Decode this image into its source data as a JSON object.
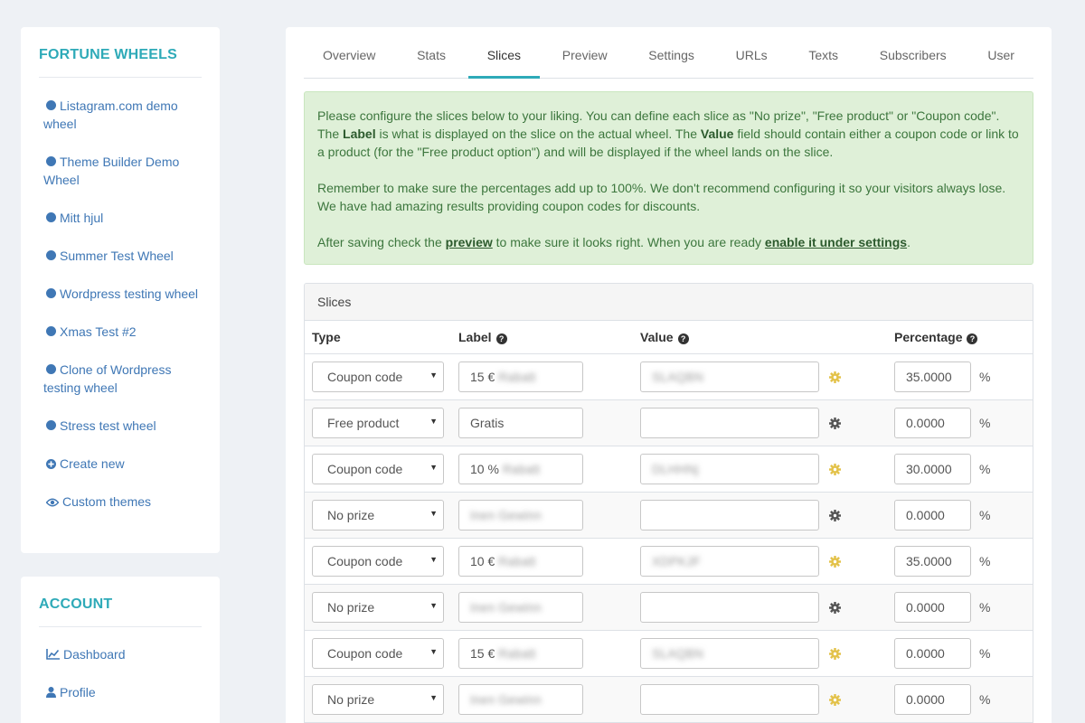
{
  "sidebar": {
    "title": "FORTUNE WHEELS",
    "wheels": [
      {
        "label": "Listagram.com demo wheel"
      },
      {
        "label": "Theme Builder Demo Wheel"
      },
      {
        "label": "Mitt hjul"
      },
      {
        "label": "Summer Test Wheel"
      },
      {
        "label": "Wordpress testing wheel"
      },
      {
        "label": "Xmas Test #2"
      },
      {
        "label": "Clone of Wordpress testing wheel"
      },
      {
        "label": "Stress test wheel"
      }
    ],
    "create_new": "Create new",
    "custom_themes": "Custom themes",
    "account_title": "ACCOUNT",
    "dashboard": "Dashboard",
    "profile": "Profile"
  },
  "tabs": [
    "Overview",
    "Stats",
    "Slices",
    "Preview",
    "Settings",
    "URLs",
    "Texts",
    "Subscribers",
    "User"
  ],
  "active_tab": "Slices",
  "info": {
    "p1_a": "Please configure the slices below to your liking. You can define each slice as \"No prize\", \"Free product\" or \"Coupon code\". The ",
    "p1_b": "Label",
    "p1_c": " is what is displayed on the slice on the actual wheel. The ",
    "p1_d": "Value",
    "p1_e": " field should contain either a coupon code or link to a product (for the \"Free product option\") and will be displayed if the wheel lands on the slice.",
    "p2": "Remember to make sure the percentages add up to 100%. We don't recommend configuring it so your visitors always lose. We have had amazing results providing coupon codes for discounts.",
    "p3_a": "After saving check the ",
    "p3_link1": "preview",
    "p3_b": " to make sure it looks right. When you are ready ",
    "p3_link2": "enable it under settings",
    "p3_c": "."
  },
  "slices": {
    "title": "Slices",
    "headers": {
      "type": "Type",
      "label": "Label",
      "value": "Value",
      "percentage": "Percentage"
    },
    "help_glyph": "?",
    "percent_sign": "%",
    "rows": [
      {
        "type": "Coupon code",
        "label": "15 €",
        "label_blur": "Rabatt",
        "value_blur": "SLAQBN",
        "gear_color": "#e3c24a",
        "percentage": "35.0000"
      },
      {
        "type": "Free product",
        "label": "Gratis",
        "label_blur": "",
        "value_blur": "",
        "gear_color": "#555555",
        "percentage": "0.0000"
      },
      {
        "type": "Coupon code",
        "label": "10 %",
        "label_blur": "Rabatt",
        "value_blur": "DLHHNj",
        "gear_color": "#e3c24a",
        "percentage": "30.0000"
      },
      {
        "type": "No prize",
        "label": "",
        "label_blur": "Inen Gewinn",
        "value_blur": "",
        "gear_color": "#555555",
        "percentage": "0.0000"
      },
      {
        "type": "Coupon code",
        "label": "10 €",
        "label_blur": "Rabatt",
        "value_blur": "XDPKJF",
        "gear_color": "#e3c24a",
        "percentage": "35.0000"
      },
      {
        "type": "No prize",
        "label": "",
        "label_blur": "Inen Gewinn",
        "value_blur": "",
        "gear_color": "#555555",
        "percentage": "0.0000"
      },
      {
        "type": "Coupon code",
        "label": "15 €",
        "label_blur": "Rabatt",
        "value_blur": "SLAQBN",
        "gear_color": "#e3c24a",
        "percentage": "0.0000"
      },
      {
        "type": "No prize",
        "label": "",
        "label_blur": "Inen Gewinn",
        "value_blur": "",
        "gear_color": "#e3c24a",
        "percentage": "0.0000"
      }
    ]
  },
  "colors": {
    "accent": "#2eaab8",
    "link": "#3f77b5",
    "info_bg": "#dff0d8",
    "gear_active": "#e3c24a",
    "gear_default": "#555555"
  }
}
